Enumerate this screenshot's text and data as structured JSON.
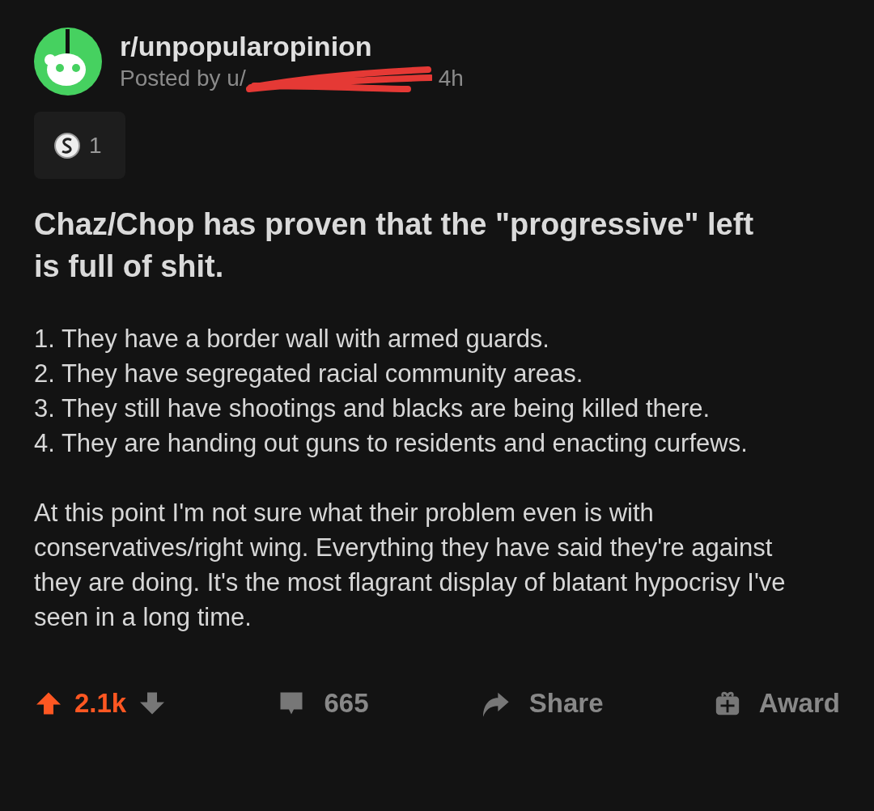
{
  "post": {
    "subreddit": "r/unpopularopinion",
    "posted_by": "Posted by u/",
    "username_redacted": true,
    "age": "4h",
    "awards": [
      {
        "count": "1"
      }
    ],
    "title": "Chaz/Chop has proven that the \"progressive\" left is full of shit.",
    "list_items": [
      "1. They have a border wall with armed guards.",
      "2. They have segregated racial community areas.",
      "3. They still have shootings and blacks are being killed there.",
      "4. They are handing out guns to residents and enacting curfews."
    ],
    "paragraph": "At this point I'm not sure what their problem even is with conservatives/right wing. Everything they have said they're against they are doing. It's the most flagrant display of blatant hypocrisy I've seen in a long time."
  },
  "actions": {
    "upvoted": true,
    "score": "2.1k",
    "comments": "665",
    "share": "Share",
    "award": "Award"
  }
}
